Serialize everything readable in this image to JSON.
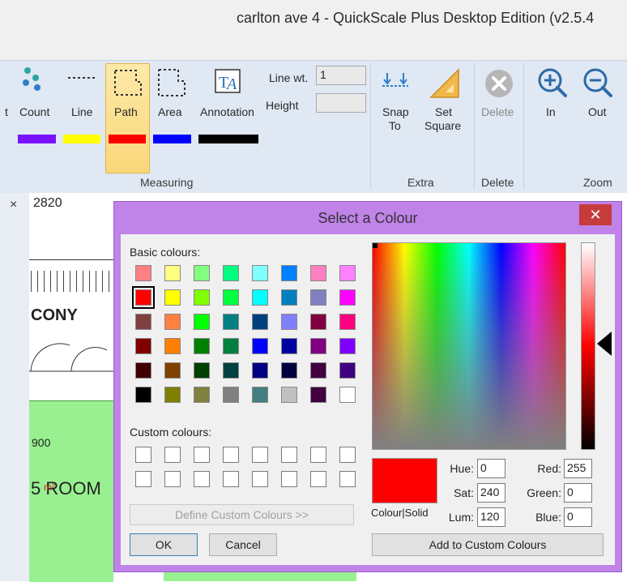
{
  "window": {
    "title": "carlton ave 4 - QuickScale Plus Desktop Edition (v2.5.4"
  },
  "ribbon": {
    "measuring": {
      "group_label": "Measuring",
      "partial_label": "t",
      "count_label": "Count",
      "line_label": "Line",
      "path_label": "Path",
      "area_label": "Area",
      "annotation_label": "Annotation",
      "line_wt_label": "Line wt.",
      "line_wt_value": "1",
      "height_label": "Height",
      "height_value": "",
      "colors": {
        "count": "#7a12ff",
        "line": "#ffff00",
        "path": "#ff0000",
        "area": "#0000ff",
        "annotation": "#000000"
      }
    },
    "extra": {
      "group_label": "Extra",
      "snap_label_1": "Snap",
      "snap_label_2": "To",
      "set_label_1": "Set",
      "set_label_2": "Square"
    },
    "delete": {
      "group_label": "Delete",
      "delete_label": "Delete"
    },
    "zoom": {
      "group_label": "Zoom",
      "in_label": "In",
      "out_label": "Out"
    }
  },
  "left_pane": {
    "close_glyph": "×"
  },
  "drawing": {
    "label_2820": "2820",
    "label_cony": "CONY",
    "label_900": "900",
    "label_room": "5 ROOM",
    "label_m2": "m²"
  },
  "dialog": {
    "title": "Select a Colour",
    "close_glyph": "✕",
    "basic_colours_label": "Basic colours:",
    "basic_colours": [
      [
        "#ff8080",
        "#ffff80",
        "#80ff80",
        "#00ff80",
        "#80ffff",
        "#0080ff",
        "#ff80c0",
        "#ff80ff"
      ],
      [
        "#ff0000",
        "#ffff00",
        "#80ff00",
        "#00ff40",
        "#00ffff",
        "#0080c0",
        "#8080c0",
        "#ff00ff"
      ],
      [
        "#804040",
        "#ff8040",
        "#00ff00",
        "#008080",
        "#004080",
        "#8080ff",
        "#800040",
        "#ff0080"
      ],
      [
        "#800000",
        "#ff8000",
        "#008000",
        "#008040",
        "#0000ff",
        "#0000a0",
        "#800080",
        "#8000ff"
      ],
      [
        "#400000",
        "#804000",
        "#004000",
        "#004040",
        "#000080",
        "#000040",
        "#400040",
        "#400080"
      ],
      [
        "#000000",
        "#808000",
        "#808040",
        "#808080",
        "#408080",
        "#c0c0c0",
        "#400040",
        "#ffffff"
      ]
    ],
    "selected_colour_index": [
      1,
      0
    ],
    "custom_colours_label": "Custom colours:",
    "define_custom_label": "Define Custom Colours >>",
    "ok_label": "OK",
    "cancel_label": "Cancel",
    "colour_solid_label": "Colour|Solid",
    "current_colour": "#ff0000",
    "hue_label": "Hue:",
    "hue_value": "0",
    "sat_label": "Sat:",
    "sat_value": "240",
    "lum_label": "Lum:",
    "lum_value": "120",
    "red_label": "Red:",
    "red_value": "255",
    "green_label": "Green:",
    "green_value": "0",
    "blue_label": "Blue:",
    "blue_value": "0",
    "add_custom_label": "Add to Custom Colours"
  }
}
